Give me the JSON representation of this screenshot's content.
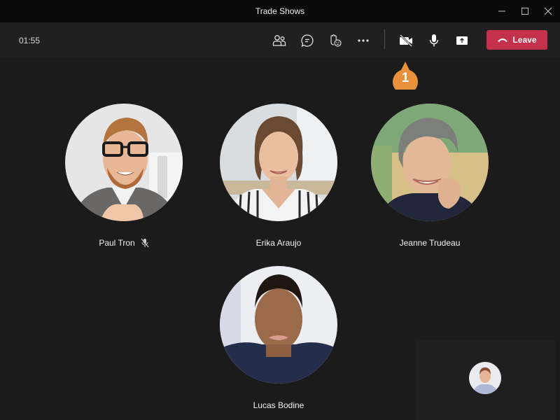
{
  "window": {
    "title": "Trade Shows",
    "controls": [
      "minimize",
      "maximize",
      "close"
    ]
  },
  "toolbar": {
    "timer": "01:55",
    "buttons": [
      {
        "name": "participants",
        "icon": "people-icon"
      },
      {
        "name": "chat",
        "icon": "chat-icon"
      },
      {
        "name": "reactions",
        "icon": "raise-hand-icon"
      },
      {
        "name": "more",
        "icon": "more-icon"
      },
      {
        "name": "camera",
        "icon": "camera-off-icon"
      },
      {
        "name": "mic",
        "icon": "microphone-icon"
      },
      {
        "name": "share",
        "icon": "share-screen-icon"
      }
    ],
    "leave_label": "Leave",
    "leave_color": "#c4314b"
  },
  "callout": {
    "number": "1",
    "color": "#e8913a",
    "target": "camera"
  },
  "participants": [
    {
      "name": "Paul Tron",
      "muted": true
    },
    {
      "name": "Erika Araujo",
      "muted": false
    },
    {
      "name": "Jeanne Trudeau",
      "muted": false
    },
    {
      "name": "Lucas Bodine",
      "muted": false
    }
  ],
  "self_view": {
    "label": "self-preview"
  }
}
